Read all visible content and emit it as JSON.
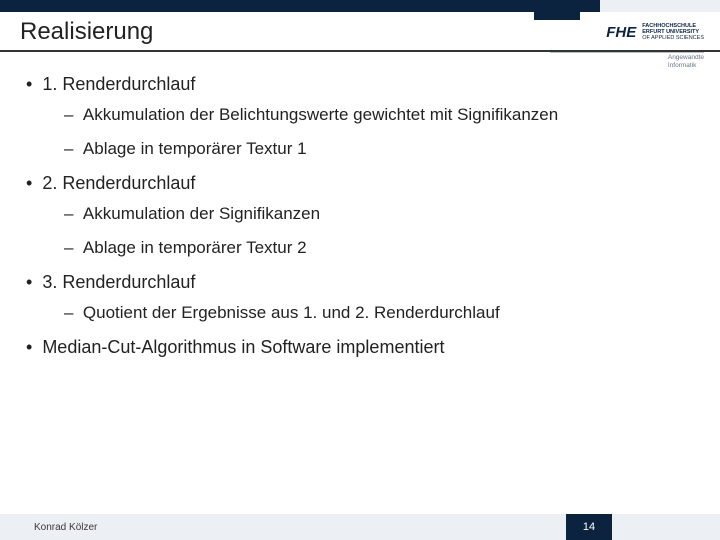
{
  "header": {
    "title": "Realisierung",
    "logo_mark": "FHE",
    "logo_line1": "FACHHOCHSCHULE",
    "logo_line2": "ERFURT UNIVERSITY",
    "logo_line3": "OF APPLIED SCIENCES",
    "dept_line1": "Angewandte",
    "dept_line2": "Informatik"
  },
  "content": {
    "bullet1": "1. Renderdurchlauf",
    "dash1a": "Akkumulation der Belichtungswerte gewichtet mit Signifikanzen",
    "dash1b": "Ablage in temporärer Textur 1",
    "bullet2": "2. Renderdurchlauf",
    "dash2a": "Akkumulation der Signifikanzen",
    "dash2b": "Ablage in temporärer Textur 2",
    "bullet3": "3. Renderdurchlauf",
    "dash3a": "Quotient der Ergebnisse aus 1. und 2. Renderdurchlauf",
    "bullet4": "Median-Cut-Algorithmus in Software implementiert"
  },
  "footer": {
    "author": "Konrad Kölzer",
    "page": "14"
  }
}
